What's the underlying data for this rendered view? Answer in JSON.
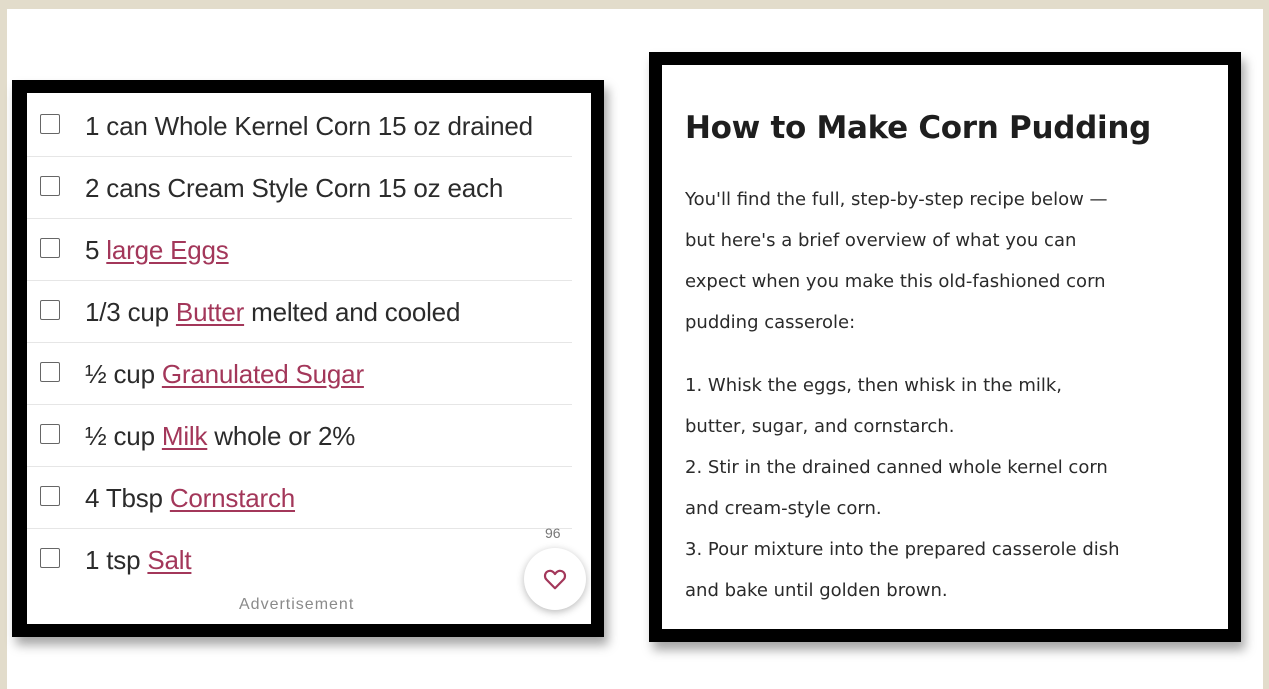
{
  "ingredients": {
    "items": [
      {
        "qty": "1 can Whole Kernel Corn 15 oz drained",
        "link": "",
        "note": ""
      },
      {
        "qty": "2 cans Cream Style Corn 15 oz each",
        "link": "",
        "note": ""
      },
      {
        "qty": "5 ",
        "link": "large Eggs",
        "note": ""
      },
      {
        "qty": "1/3 cup ",
        "link": "Butter",
        "note": " melted and cooled"
      },
      {
        "qty": "½ cup ",
        "link": "Granulated Sugar",
        "note": ""
      },
      {
        "qty": "½ cup ",
        "link": "Milk",
        "note": " whole or 2%"
      },
      {
        "qty": "4 Tbsp ",
        "link": "Cornstarch",
        "note": ""
      },
      {
        "qty": "1 tsp ",
        "link": "Salt",
        "note": ""
      }
    ],
    "ad_label": "Advertisement",
    "favorite_count": "96",
    "favorite_icon": "heart-icon",
    "link_color": "#a3375a"
  },
  "article": {
    "title": "How to Make Corn Pudding",
    "intro_lines": [
      "You'll find the full, step-by-step recipe below —",
      "but here's a brief overview of what you can",
      "expect when you make this old-fashioned corn",
      "pudding casserole:"
    ],
    "step_lines": [
      "1. Whisk the eggs, then whisk in the milk,",
      "butter, sugar, and cornstarch.",
      "2. Stir in the drained canned whole kernel corn",
      "and cream-style corn.",
      "3. Pour mixture into the prepared casserole dish",
      "and bake until golden brown."
    ]
  }
}
